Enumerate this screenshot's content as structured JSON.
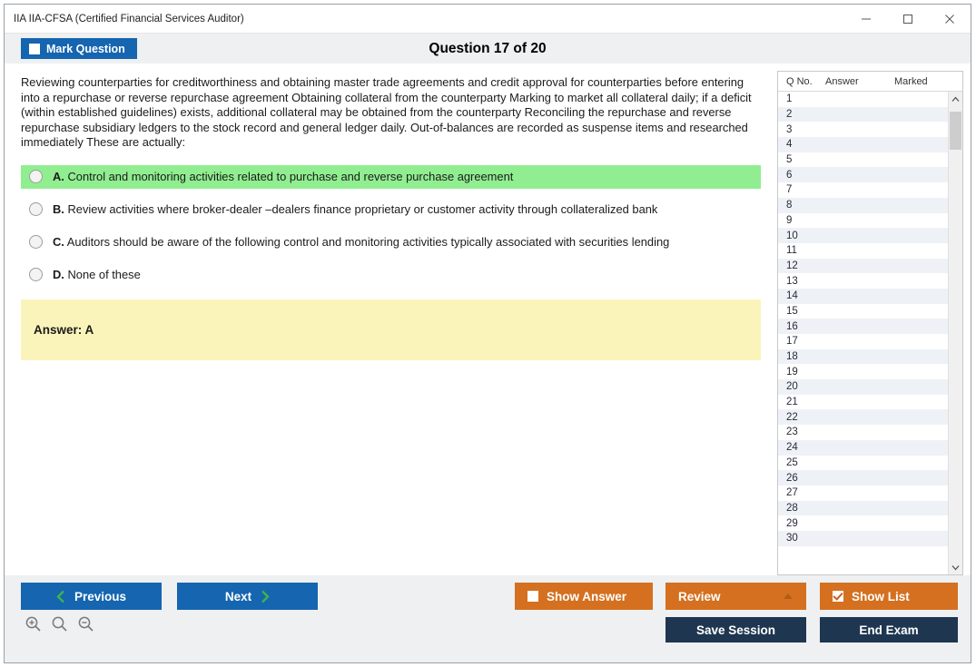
{
  "window": {
    "title": "IIA IIA-CFSA (Certified Financial Services Auditor)",
    "minimize_label": "minimize-icon",
    "maximize_label": "maximize-icon",
    "close_label": "close-icon"
  },
  "header": {
    "mark_question_label": "Mark Question",
    "mark_question_checked": false,
    "question_counter": "Question 17 of 20"
  },
  "question": {
    "text": "Reviewing counterparties for creditworthiness and obtaining master trade agreements and credit approval for counterparties before entering into a repurchase or reverse repurchase agreement Obtaining collateral from the counterparty Marking to market all collateral daily; if a deficit (within established guidelines) exists, additional collateral may be obtained from the counterparty Reconciling the repurchase and reverse repurchase subsidiary ledgers to the stock record and general ledger daily. Out-of-balances are recorded as suspense items and researched immediately These are actually:",
    "options": [
      {
        "letter": "A.",
        "text": "Control and monitoring activities related to purchase and reverse purchase agreement",
        "correct": true,
        "selected": false
      },
      {
        "letter": "B.",
        "text": "Review activities where broker-dealer –dealers finance proprietary or customer activity through collateralized bank",
        "correct": false,
        "selected": false
      },
      {
        "letter": "C.",
        "text": "Auditors should be aware of the following control and monitoring activities typically associated with securities lending",
        "correct": false,
        "selected": false
      },
      {
        "letter": "D.",
        "text": "None of these",
        "correct": false,
        "selected": false
      }
    ],
    "answer_label": "Answer: A"
  },
  "question_list": {
    "columns": [
      "Q No.",
      "Answer",
      "Marked"
    ],
    "rows": [
      {
        "qno": "1",
        "answer": "",
        "marked": ""
      },
      {
        "qno": "2",
        "answer": "",
        "marked": ""
      },
      {
        "qno": "3",
        "answer": "",
        "marked": ""
      },
      {
        "qno": "4",
        "answer": "",
        "marked": ""
      },
      {
        "qno": "5",
        "answer": "",
        "marked": ""
      },
      {
        "qno": "6",
        "answer": "",
        "marked": ""
      },
      {
        "qno": "7",
        "answer": "",
        "marked": ""
      },
      {
        "qno": "8",
        "answer": "",
        "marked": ""
      },
      {
        "qno": "9",
        "answer": "",
        "marked": ""
      },
      {
        "qno": "10",
        "answer": "",
        "marked": ""
      },
      {
        "qno": "11",
        "answer": "",
        "marked": ""
      },
      {
        "qno": "12",
        "answer": "",
        "marked": ""
      },
      {
        "qno": "13",
        "answer": "",
        "marked": ""
      },
      {
        "qno": "14",
        "answer": "",
        "marked": ""
      },
      {
        "qno": "15",
        "answer": "",
        "marked": ""
      },
      {
        "qno": "16",
        "answer": "",
        "marked": ""
      },
      {
        "qno": "17",
        "answer": "",
        "marked": ""
      },
      {
        "qno": "18",
        "answer": "",
        "marked": ""
      },
      {
        "qno": "19",
        "answer": "",
        "marked": ""
      },
      {
        "qno": "20",
        "answer": "",
        "marked": ""
      },
      {
        "qno": "21",
        "answer": "",
        "marked": ""
      },
      {
        "qno": "22",
        "answer": "",
        "marked": ""
      },
      {
        "qno": "23",
        "answer": "",
        "marked": ""
      },
      {
        "qno": "24",
        "answer": "",
        "marked": ""
      },
      {
        "qno": "25",
        "answer": "",
        "marked": ""
      },
      {
        "qno": "26",
        "answer": "",
        "marked": ""
      },
      {
        "qno": "27",
        "answer": "",
        "marked": ""
      },
      {
        "qno": "28",
        "answer": "",
        "marked": ""
      },
      {
        "qno": "29",
        "answer": "",
        "marked": ""
      },
      {
        "qno": "30",
        "answer": "",
        "marked": ""
      }
    ]
  },
  "footer": {
    "previous_label": "Previous",
    "next_label": "Next",
    "show_answer_label": "Show Answer",
    "show_answer_checked": false,
    "review_label": "Review",
    "show_list_label": "Show List",
    "show_list_checked": true,
    "save_session_label": "Save Session",
    "end_exam_label": "End Exam",
    "zoom_in_label": "zoom-in-icon",
    "zoom_reset_label": "zoom-reset-icon",
    "zoom_out_label": "zoom-out-icon"
  },
  "colors": {
    "blue": "#1565b0",
    "orange": "#d4701f",
    "navy": "#1e3650",
    "correct_highlight": "#90ee90",
    "answer_box": "#fbf4ba"
  }
}
